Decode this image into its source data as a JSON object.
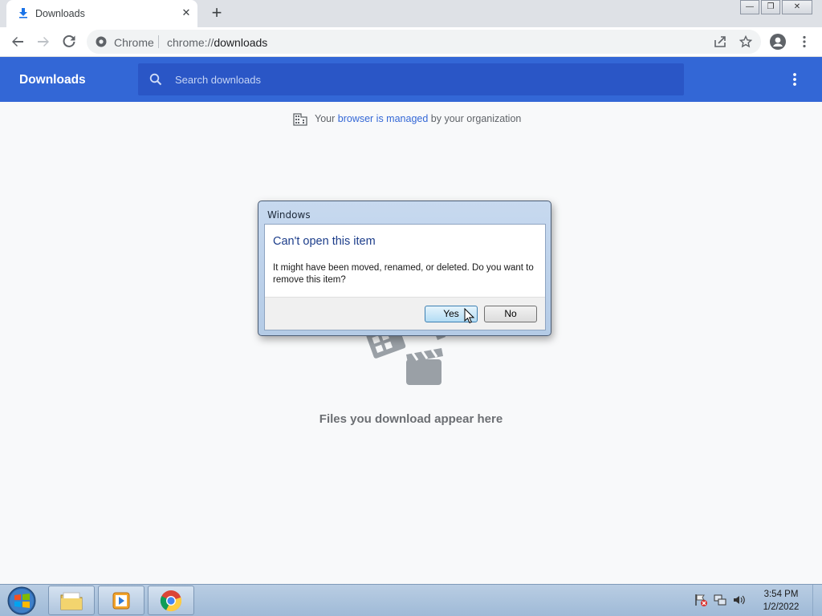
{
  "browser": {
    "tab": {
      "title": "Downloads",
      "icon": "download-icon"
    },
    "new_tab_label": "+",
    "window_controls": {
      "minimize": "—",
      "restore": "❐",
      "close": "✕"
    },
    "omnibox": {
      "site_label": "Chrome",
      "url_scheme": "chrome://",
      "url_host": "downloads"
    }
  },
  "downloads_page": {
    "title": "Downloads",
    "search": {
      "placeholder": "Search downloads",
      "value": ""
    },
    "managed_notice": {
      "prefix": "Your",
      "link": "browser is managed",
      "suffix": "by your organization"
    },
    "empty_message": "Files you download appear here"
  },
  "dialog": {
    "caption": "Windows",
    "heading": "Can't open this item",
    "message": "It might have been moved, renamed, or deleted. Do you want to remove this item?",
    "buttons": {
      "yes": "Yes",
      "no": "No"
    }
  },
  "taskbar": {
    "pinned": [
      "file-explorer-icon",
      "media-player-icon",
      "chrome-icon"
    ],
    "clock": {
      "time": "3:54 PM",
      "date": "1/2/2022"
    }
  },
  "colors": {
    "header_blue": "#3367d6",
    "search_blue": "#2a56c6",
    "link_blue": "#3367d6"
  }
}
